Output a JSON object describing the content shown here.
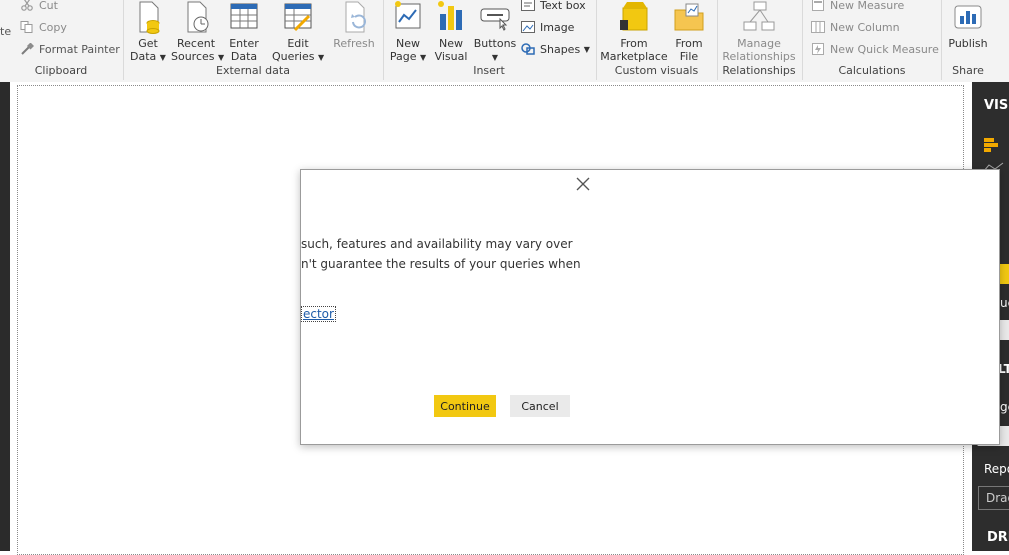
{
  "ribbon": {
    "clipboard": {
      "paste_partial": "te",
      "cut": "Cut",
      "copy": "Copy",
      "format_painter": "Format Painter",
      "group": "Clipboard"
    },
    "external_data": {
      "get_data": [
        "Get",
        "Data"
      ],
      "recent_sources": [
        "Recent",
        "Sources"
      ],
      "enter_data": [
        "Enter",
        "Data"
      ],
      "edit_queries": [
        "Edit",
        "Queries"
      ],
      "refresh": "Refresh",
      "group": "External data"
    },
    "insert": {
      "new_page": [
        "New",
        "Page"
      ],
      "new_visual": [
        "New",
        "Visual"
      ],
      "buttons": "Buttons",
      "text_box": "Text box",
      "image": "Image",
      "shapes": "Shapes",
      "group": "Insert"
    },
    "custom_visuals": {
      "from_marketplace": [
        "From",
        "Marketplace"
      ],
      "from_file": [
        "From",
        "File"
      ],
      "group": "Custom visuals"
    },
    "relationships": {
      "manage": [
        "Manage",
        "Relationships"
      ],
      "group": "Relationships"
    },
    "calculations": {
      "new_measure": "New Measure",
      "new_column": "New Column",
      "new_quick_measure": "New Quick Measure",
      "group": "Calculations"
    },
    "share": {
      "publish": "Publish",
      "group": "Share"
    }
  },
  "right_pane": {
    "visualizations_partial": "VISU",
    "filters_partial": "LT",
    "page_partial": "ge",
    "report_partial": "Repo",
    "drag_partial": "Drag",
    "drillthrough_partial": "DRI",
    "values_partial": "ue"
  },
  "dialog": {
    "line1": "such, features and availability may vary over",
    "line2": "n't guarantee the results of your queries when",
    "link": "ector",
    "continue": "Continue",
    "cancel": "Cancel"
  },
  "colors": {
    "accent": "#f2c811",
    "link": "#1d5ba8",
    "pane_dark": "#2d2d2d"
  }
}
